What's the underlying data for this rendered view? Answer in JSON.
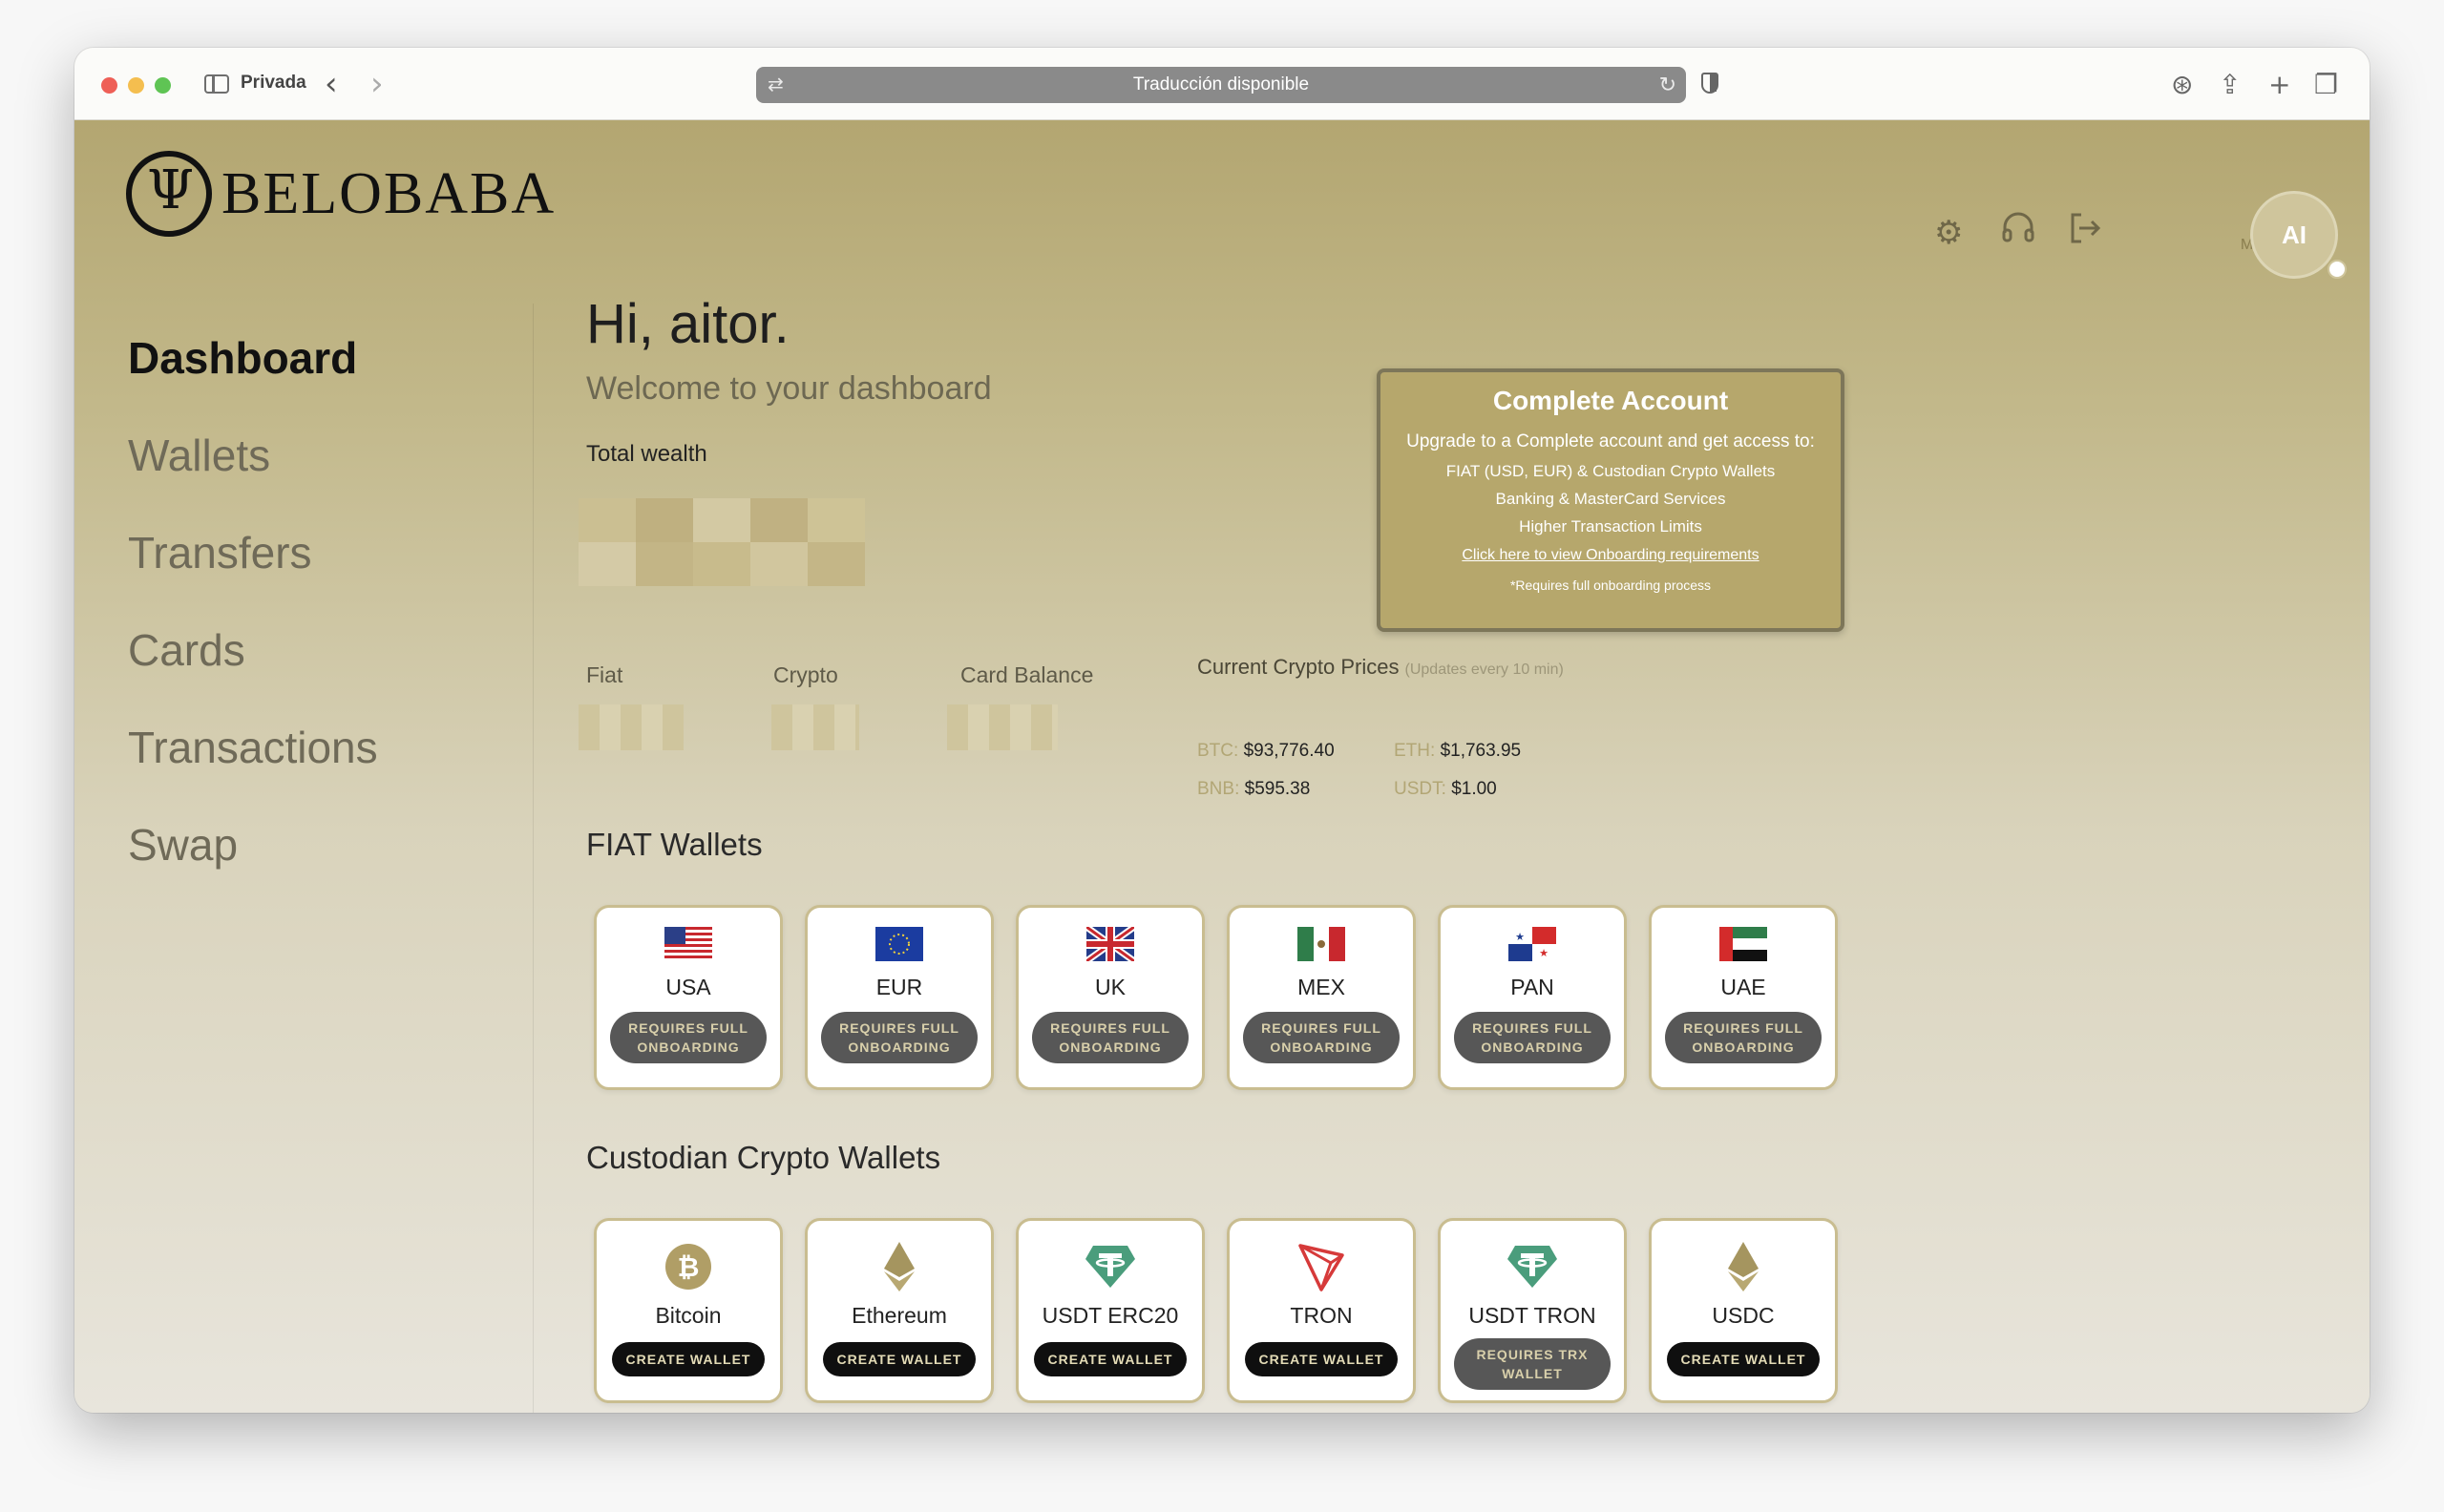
{
  "browser": {
    "mode_label": "Privada",
    "address_text": "Traducción disponible"
  },
  "brand": {
    "name": "BELOBABA"
  },
  "header": {
    "user_name": "aitor",
    "profile_link": "My Profile",
    "avatar_initials": "AI"
  },
  "nav": {
    "items": [
      {
        "label": "Dashboard",
        "active": true
      },
      {
        "label": "Wallets"
      },
      {
        "label": "Transfers"
      },
      {
        "label": "Cards"
      },
      {
        "label": "Transactions"
      },
      {
        "label": "Swap"
      }
    ]
  },
  "dashboard": {
    "greeting": "Hi, aitor.",
    "welcome": "Welcome to your dashboard",
    "total_wealth_label": "Total wealth",
    "fiat_label": "Fiat",
    "crypto_label": "Crypto",
    "card_balance_label": "Card Balance"
  },
  "prices": {
    "title": "Current Crypto Prices",
    "note": "(Updates every 10 min)",
    "btc_key": "BTC:",
    "btc_value": "$93,776.40",
    "eth_key": "ETH:",
    "eth_value": "$1,763.95",
    "bnb_key": "BNB:",
    "bnb_value": "$595.38",
    "usdt_key": "USDT:",
    "usdt_value": "$1.00"
  },
  "complete_account": {
    "title": "Complete Account",
    "lead": "Upgrade to a Complete account and get access to:",
    "line1": "FIAT (USD, EUR) & Custodian Crypto Wallets",
    "line2": "Banking & MasterCard Services",
    "line3": "Higher Transaction Limits",
    "link": "Click here to view Onboarding requirements",
    "note": "*Requires full onboarding process"
  },
  "fiat_wallets": {
    "title": "FIAT Wallets",
    "requires_line1": "REQUIRES FULL",
    "requires_line2": "ONBOARDING",
    "items": [
      {
        "name": "USA"
      },
      {
        "name": "EUR"
      },
      {
        "name": "UK"
      },
      {
        "name": "MEX"
      },
      {
        "name": "PAN"
      },
      {
        "name": "UAE"
      }
    ]
  },
  "crypto_wallets": {
    "title": "Custodian Crypto Wallets",
    "create_label": "CREATE WALLET",
    "requires_trx_line1": "REQUIRES TRX",
    "requires_trx_line2": "WALLET",
    "items": [
      {
        "name": "Bitcoin",
        "icon": "bitcoin-icon"
      },
      {
        "name": "Ethereum",
        "icon": "ethereum-icon"
      },
      {
        "name": "USDT ERC20",
        "icon": "tether-icon"
      },
      {
        "name": "TRON",
        "icon": "tron-icon"
      },
      {
        "name": "USDT TRON",
        "icon": "tether-icon"
      },
      {
        "name": "USDC",
        "icon": "ethereum-icon"
      }
    ]
  },
  "colors": {
    "brand_gold": "#b6a76c",
    "pill_grey": "#575757",
    "pill_black": "#0f0f0f",
    "tether_green": "#4a9d7c",
    "tron_red": "#d63a3a"
  }
}
